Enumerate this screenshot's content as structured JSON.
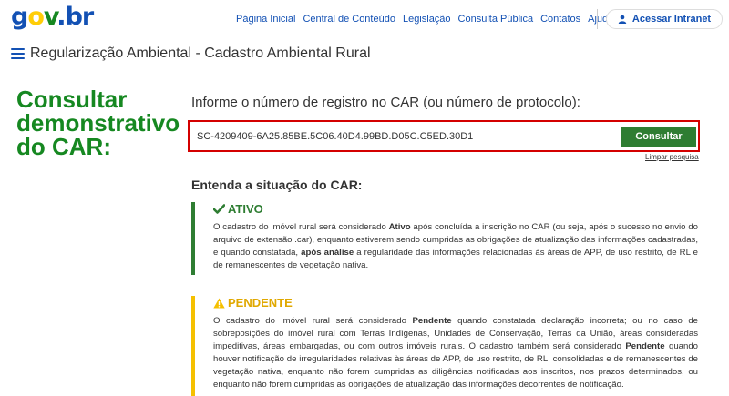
{
  "header": {
    "logo": {
      "g": "g",
      "o": "o",
      "v": "v",
      "dot": ".",
      "b": "b",
      "r": "r"
    },
    "nav": [
      "Página Inicial",
      "Central de Conteúdo",
      "Legislação",
      "Consulta Pública",
      "Contatos",
      "Ajuda"
    ],
    "login_label": "Acessar Intranet"
  },
  "title_bar": {
    "title": "Regularização Ambiental - Cadastro Ambiental Rural"
  },
  "left_heading": {
    "line1": "Consultar",
    "line2": "demonstrativo",
    "line3": "do CAR:"
  },
  "form": {
    "label": "Informe o número de registro no CAR (ou número de protocolo):",
    "value": "SC-4209409-6A25.85BE.5C06.40D4.99BD.D05C.C5ED.30D1",
    "button": "Consultar",
    "clear": "Limpar pesquisa"
  },
  "section": {
    "heading": "Entenda a situação do CAR:"
  },
  "statuses": {
    "ativo": {
      "title": "ATIVO",
      "t1": "O cadastro do imóvel rural será considerado ",
      "b1": "Ativo",
      "t2": " após concluída a inscrição no CAR (ou seja, após o sucesso no envio do arquivo de extensão .car), enquanto estiverem sendo cumpridas as obrigações de atualização das informações cadastradas, e quando constatada, ",
      "b2": "após análise",
      "t3": " a regularidade das informações relacionadas às áreas de APP, de uso restrito, de RL e de remanescentes de vegetação nativa."
    },
    "pendente": {
      "title": "PENDENTE",
      "t1": "O cadastro do imóvel rural será considerado ",
      "b1": "Pendente",
      "t2": " quando constatada declaração incorreta; ou no caso de sobreposições do imóvel rural com Terras Indígenas, Unidades de Conservação, Terras da União, áreas consideradas impeditivas, áreas embargadas, ou com outros imóveis rurais. O cadastro também será considerado ",
      "b2": "Pendente",
      "t3": " quando houver notificação de irregularidades relativas às áreas de APP, de uso restrito, de RL, consolidadas e de remanescentes de vegetação nativa, enquanto não forem cumpridas as diligências notificadas aos inscritos, nos prazos determinados, ou enquanto não forem cumpridas as obrigações de atualização das informações decorrentes de notificação."
    }
  },
  "colors": {
    "brand_blue": "#1351b4",
    "green": "#2e7d32",
    "yellow": "#f5c000",
    "error_red": "#d40000"
  }
}
